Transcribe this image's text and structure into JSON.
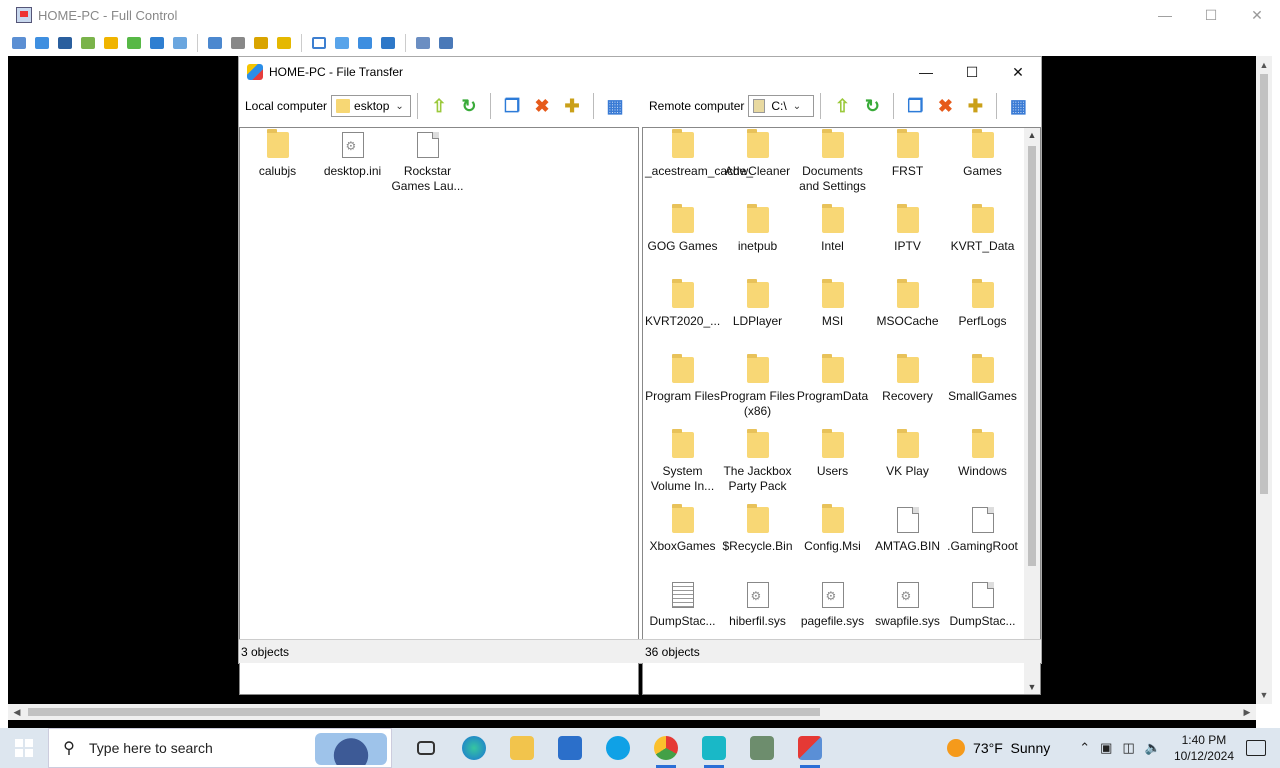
{
  "outer_window": {
    "title": "HOME-PC - Full Control"
  },
  "file_transfer": {
    "title": "HOME-PC - File Transfer",
    "local": {
      "label": "Local computer",
      "path": "esktop",
      "status": "3 objects",
      "items": [
        {
          "name": "calubjs",
          "kind": "folder"
        },
        {
          "name": "desktop.ini",
          "kind": "sysfile"
        },
        {
          "name": "Rockstar Games Lau...",
          "kind": "file"
        }
      ]
    },
    "remote": {
      "label": "Remote computer",
      "path": "C:\\",
      "status": "36 objects",
      "items": [
        {
          "name": "_acestream_cache_",
          "kind": "folder"
        },
        {
          "name": "AdwCleaner",
          "kind": "folder"
        },
        {
          "name": "Documents and Settings",
          "kind": "folder"
        },
        {
          "name": "FRST",
          "kind": "folder"
        },
        {
          "name": "Games",
          "kind": "folder"
        },
        {
          "name": "GOG Games",
          "kind": "folder"
        },
        {
          "name": "inetpub",
          "kind": "folder"
        },
        {
          "name": "Intel",
          "kind": "folder"
        },
        {
          "name": "IPTV",
          "kind": "folder"
        },
        {
          "name": "KVRT_Data",
          "kind": "folder"
        },
        {
          "name": "KVRT2020_...",
          "kind": "folder"
        },
        {
          "name": "LDPlayer",
          "kind": "folder"
        },
        {
          "name": "MSI",
          "kind": "folder"
        },
        {
          "name": "MSOCache",
          "kind": "folder"
        },
        {
          "name": "PerfLogs",
          "kind": "folder"
        },
        {
          "name": "Program Files",
          "kind": "folder"
        },
        {
          "name": "Program Files (x86)",
          "kind": "folder"
        },
        {
          "name": "ProgramData",
          "kind": "folder"
        },
        {
          "name": "Recovery",
          "kind": "folder"
        },
        {
          "name": "SmallGames",
          "kind": "folder"
        },
        {
          "name": "System Volume In...",
          "kind": "folder"
        },
        {
          "name": "The Jackbox Party Pack",
          "kind": "folder"
        },
        {
          "name": "Users",
          "kind": "folder"
        },
        {
          "name": "VK Play",
          "kind": "folder"
        },
        {
          "name": "Windows",
          "kind": "folder"
        },
        {
          "name": "XboxGames",
          "kind": "folder"
        },
        {
          "name": "$Recycle.Bin",
          "kind": "folder"
        },
        {
          "name": "Config.Msi",
          "kind": "folder"
        },
        {
          "name": "AMTAG.BIN",
          "kind": "file"
        },
        {
          "name": ".GamingRoot",
          "kind": "file"
        },
        {
          "name": "DumpStac...",
          "kind": "txtfile"
        },
        {
          "name": "hiberfil.sys",
          "kind": "sysfile"
        },
        {
          "name": "pagefile.sys",
          "kind": "sysfile"
        },
        {
          "name": "swapfile.sys",
          "kind": "sysfile"
        },
        {
          "name": "DumpStac...",
          "kind": "file"
        }
      ]
    }
  },
  "taskbar": {
    "search_placeholder": "Type here to search",
    "weather_temp": "73°F",
    "weather_cond": "Sunny",
    "time": "1:40 PM",
    "date": "10/12/2024"
  },
  "colors": {
    "folder": "#f8d775",
    "accent": "#2a6fd6"
  }
}
